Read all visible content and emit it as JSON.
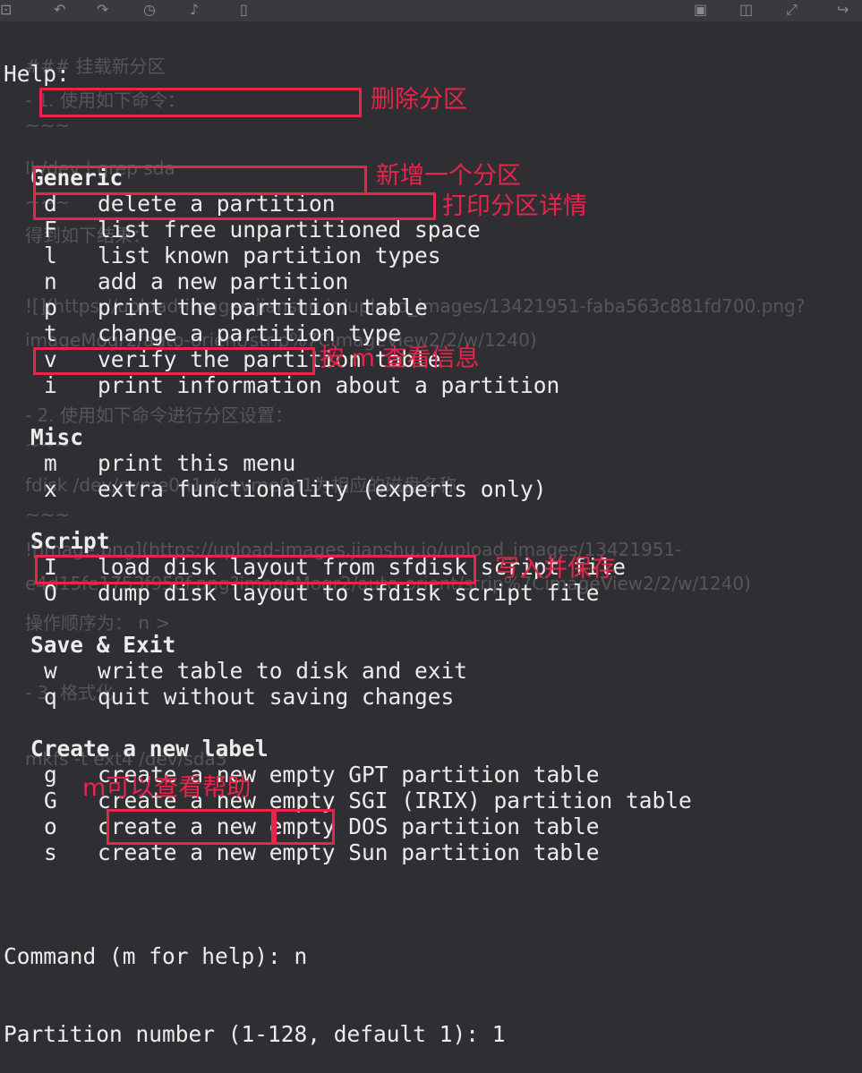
{
  "toolbar": {
    "icons": [
      "save-icon",
      "undo-icon",
      "redo-icon",
      "history-icon",
      "audio-icon",
      "document-icon",
      "disk-icon",
      "split-view-icon",
      "fullscreen-icon",
      "share-icon"
    ]
  },
  "background_notes": [
    "### 挂载新分区",
    "- 1. 使用如下命令：",
    "~~~",
    "ll /dev | grep sda",
    "~~~",
    "得到如下结果：",
    "![](https://upload-images.jianshu.io/upload_images/13421951-faba563c881fd700.png?",
    "imageMogr2/auto-orient/strip%7CimageView2/2/w/1240)",
    "- 2. 使用如下命令进行分区设置：",
    "~~~",
    "fdisk /dev/nvme0n1   # nvme0n1为相应的磁盘名称",
    "~~~",
    "![image.png](https://upload-images.jianshu.io/upload_images/13421951-",
    "e4d15fe1753f958f.png?imageMogr2/auto-orient/strip%7CimageView2/2/w/1240)",
    "操作顺序为：  n >",
    "- 3. 格式化",
    "mkfs -t ext4 /dev/sda3"
  ],
  "terminal": {
    "help_title": "Help:",
    "sections": [
      {
        "title": "Generic",
        "items": [
          {
            "key": "d",
            "desc": "delete a partition"
          },
          {
            "key": "F",
            "desc": "list free unpartitioned space"
          },
          {
            "key": "l",
            "desc": "list known partition types"
          },
          {
            "key": "n",
            "desc": "add a new partition"
          },
          {
            "key": "p",
            "desc": "print the partition table"
          },
          {
            "key": "t",
            "desc": "change a partition type"
          },
          {
            "key": "v",
            "desc": "verify the partition table"
          },
          {
            "key": "i",
            "desc": "print information about a partition"
          }
        ]
      },
      {
        "title": "Misc",
        "items": [
          {
            "key": "m",
            "desc": "print this menu"
          },
          {
            "key": "x",
            "desc": "extra functionality (experts only)"
          }
        ]
      },
      {
        "title": "Script",
        "items": [
          {
            "key": "I",
            "desc": "load disk layout from sfdisk script file"
          },
          {
            "key": "O",
            "desc": "dump disk layout to sfdisk script file"
          }
        ]
      },
      {
        "title": "Save & Exit",
        "items": [
          {
            "key": "w",
            "desc": "write table to disk and exit"
          },
          {
            "key": "q",
            "desc": "quit without saving changes"
          }
        ]
      },
      {
        "title": "Create a new label",
        "items": [
          {
            "key": "g",
            "desc": "create a new empty GPT partition table"
          },
          {
            "key": "G",
            "desc": "create a new empty SGI (IRIX) partition table"
          },
          {
            "key": "o",
            "desc": "create a new empty DOS partition table"
          },
          {
            "key": "s",
            "desc": "create a new empty Sun partition table"
          }
        ]
      }
    ],
    "command_prompt": "Command (m for help): n",
    "partial_line": "Partition number (1-128, default 1): 1"
  },
  "annotations": {
    "delete": "删除分区",
    "new": "新增一个分区",
    "print": "打印分区详情",
    "menu": "按 m 查看信息",
    "write": "写入并保存",
    "help": "m可以查看帮助"
  },
  "colors": {
    "annotation": "#e8244a",
    "background": "#2f2f33",
    "text": "#ececec"
  }
}
